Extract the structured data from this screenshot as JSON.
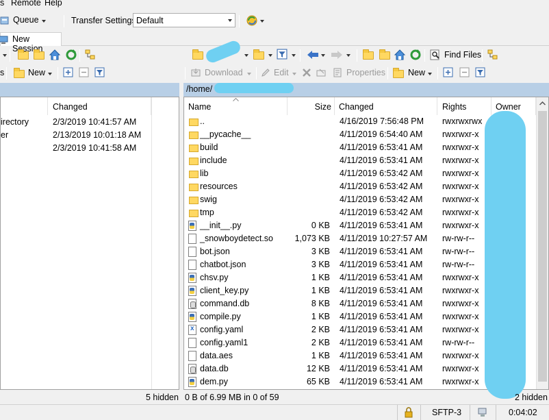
{
  "menu": {
    "items": [
      "s",
      "Remote",
      "Help"
    ]
  },
  "toolbar": {
    "queue_label": "Queue",
    "transfer_settings_label": "Transfer Settings",
    "transfer_settings_value": "Default"
  },
  "session_tab": {
    "label": "New Session"
  },
  "left_toolbar": {
    "new_label": "New"
  },
  "right_toolbar": {
    "find_files_label": "Find Files",
    "download_label": "Download",
    "edit_label": "Edit",
    "properties_label": "Properties",
    "new_label": "New"
  },
  "left_panel": {
    "columns": {
      "type": "",
      "changed": "Changed"
    },
    "rows": [
      {
        "type": "irectory",
        "changed": "2/3/2019  10:41:57 AM"
      },
      {
        "type": "er",
        "changed": "2/13/2019  10:01:18 AM"
      },
      {
        "type": "",
        "changed": "2/3/2019  10:41:58 AM"
      }
    ],
    "status": "5 hidden"
  },
  "right_panel": {
    "path": "/home/",
    "columns": {
      "name": "Name",
      "size": "Size",
      "changed": "Changed",
      "rights": "Rights",
      "owner": "Owner"
    },
    "rows": [
      {
        "icon": "parent-dir",
        "name": "..",
        "size": "",
        "changed": "4/16/2019 7:56:48 PM",
        "rights": "rwxrwxrwx"
      },
      {
        "icon": "folder",
        "name": "__pycache__",
        "size": "",
        "changed": "4/11/2019 6:54:40 AM",
        "rights": "rwxrwxr-x"
      },
      {
        "icon": "folder",
        "name": "build",
        "size": "",
        "changed": "4/11/2019 6:53:41 AM",
        "rights": "rwxrwxr-x"
      },
      {
        "icon": "folder",
        "name": "include",
        "size": "",
        "changed": "4/11/2019 6:53:41 AM",
        "rights": "rwxrwxr-x"
      },
      {
        "icon": "folder",
        "name": "lib",
        "size": "",
        "changed": "4/11/2019 6:53:42 AM",
        "rights": "rwxrwxr-x"
      },
      {
        "icon": "folder",
        "name": "resources",
        "size": "",
        "changed": "4/11/2019 6:53:42 AM",
        "rights": "rwxrwxr-x"
      },
      {
        "icon": "folder",
        "name": "swig",
        "size": "",
        "changed": "4/11/2019 6:53:42 AM",
        "rights": "rwxrwxr-x"
      },
      {
        "icon": "folder",
        "name": "tmp",
        "size": "",
        "changed": "4/11/2019 6:53:42 AM",
        "rights": "rwxrwxr-x"
      },
      {
        "icon": "py",
        "name": "__init__.py",
        "size": "0 KB",
        "changed": "4/11/2019 6:53:41 AM",
        "rights": "rwxrwxr-x"
      },
      {
        "icon": "file",
        "name": "_snowboydetect.so",
        "size": "1,073 KB",
        "changed": "4/11/2019 10:27:57 AM",
        "rights": "rw-rw-r--"
      },
      {
        "icon": "file",
        "name": "bot.json",
        "size": "3 KB",
        "changed": "4/11/2019 6:53:41 AM",
        "rights": "rw-rw-r--"
      },
      {
        "icon": "file",
        "name": "chatbot.json",
        "size": "3 KB",
        "changed": "4/11/2019 6:53:41 AM",
        "rights": "rw-rw-r--"
      },
      {
        "icon": "py",
        "name": "chsv.py",
        "size": "1 KB",
        "changed": "4/11/2019 6:53:41 AM",
        "rights": "rwxrwxr-x"
      },
      {
        "icon": "py",
        "name": "client_key.py",
        "size": "1 KB",
        "changed": "4/11/2019 6:53:41 AM",
        "rights": "rwxrwxr-x"
      },
      {
        "icon": "db",
        "name": "command.db",
        "size": "8 KB",
        "changed": "4/11/2019 6:53:41 AM",
        "rights": "rwxrwxr-x"
      },
      {
        "icon": "py",
        "name": "compile.py",
        "size": "1 KB",
        "changed": "4/11/2019 6:53:41 AM",
        "rights": "rwxrwxr-x"
      },
      {
        "icon": "yaml",
        "name": "config.yaml",
        "size": "2 KB",
        "changed": "4/11/2019 6:53:41 AM",
        "rights": "rwxrwxr-x"
      },
      {
        "icon": "file",
        "name": "config.yaml1",
        "size": "2 KB",
        "changed": "4/11/2019 6:53:41 AM",
        "rights": "rw-rw-r--"
      },
      {
        "icon": "file",
        "name": "data.aes",
        "size": "1 KB",
        "changed": "4/11/2019 6:53:41 AM",
        "rights": "rwxrwxr-x"
      },
      {
        "icon": "db",
        "name": "data.db",
        "size": "12 KB",
        "changed": "4/11/2019 6:53:41 AM",
        "rights": "rwxrwxr-x"
      },
      {
        "icon": "py",
        "name": "dem.py",
        "size": "65 KB",
        "changed": "4/11/2019 6:53:41 AM",
        "rights": "rwxrwxr-x"
      }
    ],
    "status": "0 B of 6.99 MB in 0 of 59",
    "hidden": "2 hidden"
  },
  "statusbar": {
    "protocol": "SFTP-3",
    "elapsed": "0:04:02"
  },
  "colors": {
    "path_bar": "#b8cfe6",
    "redaction": "#6fd0f2",
    "folder": "#ffd861"
  }
}
